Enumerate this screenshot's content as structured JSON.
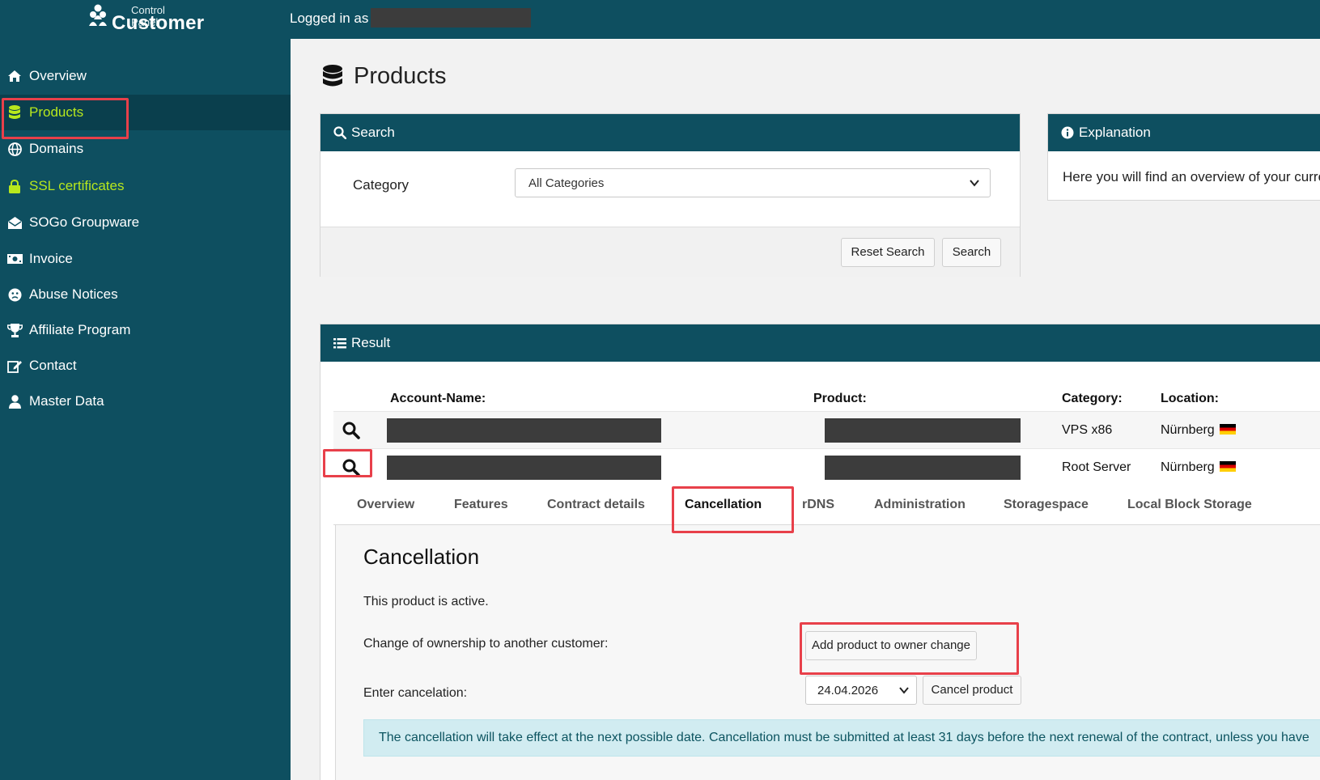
{
  "header": {
    "logo_small": "Control Panel",
    "logo_big": "Customer",
    "logged_in_label": "Logged in as"
  },
  "sidebar": {
    "items": [
      {
        "label": "Overview",
        "icon": "home-icon"
      },
      {
        "label": "Products",
        "icon": "database-icon",
        "active": true
      },
      {
        "label": "Domains",
        "icon": "globe-icon"
      },
      {
        "label": "SSL certificates",
        "icon": "lock-icon"
      },
      {
        "label": "SOGo Groupware",
        "icon": "envelope-open-icon"
      },
      {
        "label": "Invoice",
        "icon": "money-bill-icon"
      },
      {
        "label": "Abuse Notices",
        "icon": "frown-icon"
      },
      {
        "label": "Affiliate Program",
        "icon": "trophy-icon"
      },
      {
        "label": "Contact",
        "icon": "edit-icon"
      },
      {
        "label": "Master Data",
        "icon": "user-icon"
      }
    ]
  },
  "page": {
    "title": "Products"
  },
  "search": {
    "heading": "Search",
    "category_label": "Category",
    "category_value": "All Categories",
    "reset_label": "Reset Search",
    "search_label": "Search"
  },
  "explanation": {
    "heading": "Explanation",
    "text": "Here you will find an overview of your curre"
  },
  "result": {
    "heading": "Result",
    "columns": [
      "Account-Name:",
      "Product:",
      "Category:",
      "Location:"
    ],
    "rows": [
      {
        "category": "VPS x86",
        "location": "Nürnberg"
      },
      {
        "category": "Root Server",
        "location": "Nürnberg"
      }
    ]
  },
  "tabs": [
    "Overview",
    "Features",
    "Contract details",
    "Cancellation",
    "rDNS",
    "Administration",
    "Storagespace",
    "Local Block Storage"
  ],
  "cancellation": {
    "title": "Cancellation",
    "status": "This product is active.",
    "owner_change_label": "Change of ownership to another customer:",
    "owner_change_button": "Add product to owner change",
    "enter_label": "Enter cancelation:",
    "date_value": "24.04.2026",
    "cancel_button": "Cancel product",
    "info": "The cancellation will take effect at the next possible date. Cancellation must be submitted at least 31 days before the next renewal of the contract, unless you have"
  },
  "colors": {
    "brand": "#0e4f60",
    "active_nav": "#b8e81d",
    "highlight": "#e8404a",
    "info_bg": "#d1ecf1"
  }
}
